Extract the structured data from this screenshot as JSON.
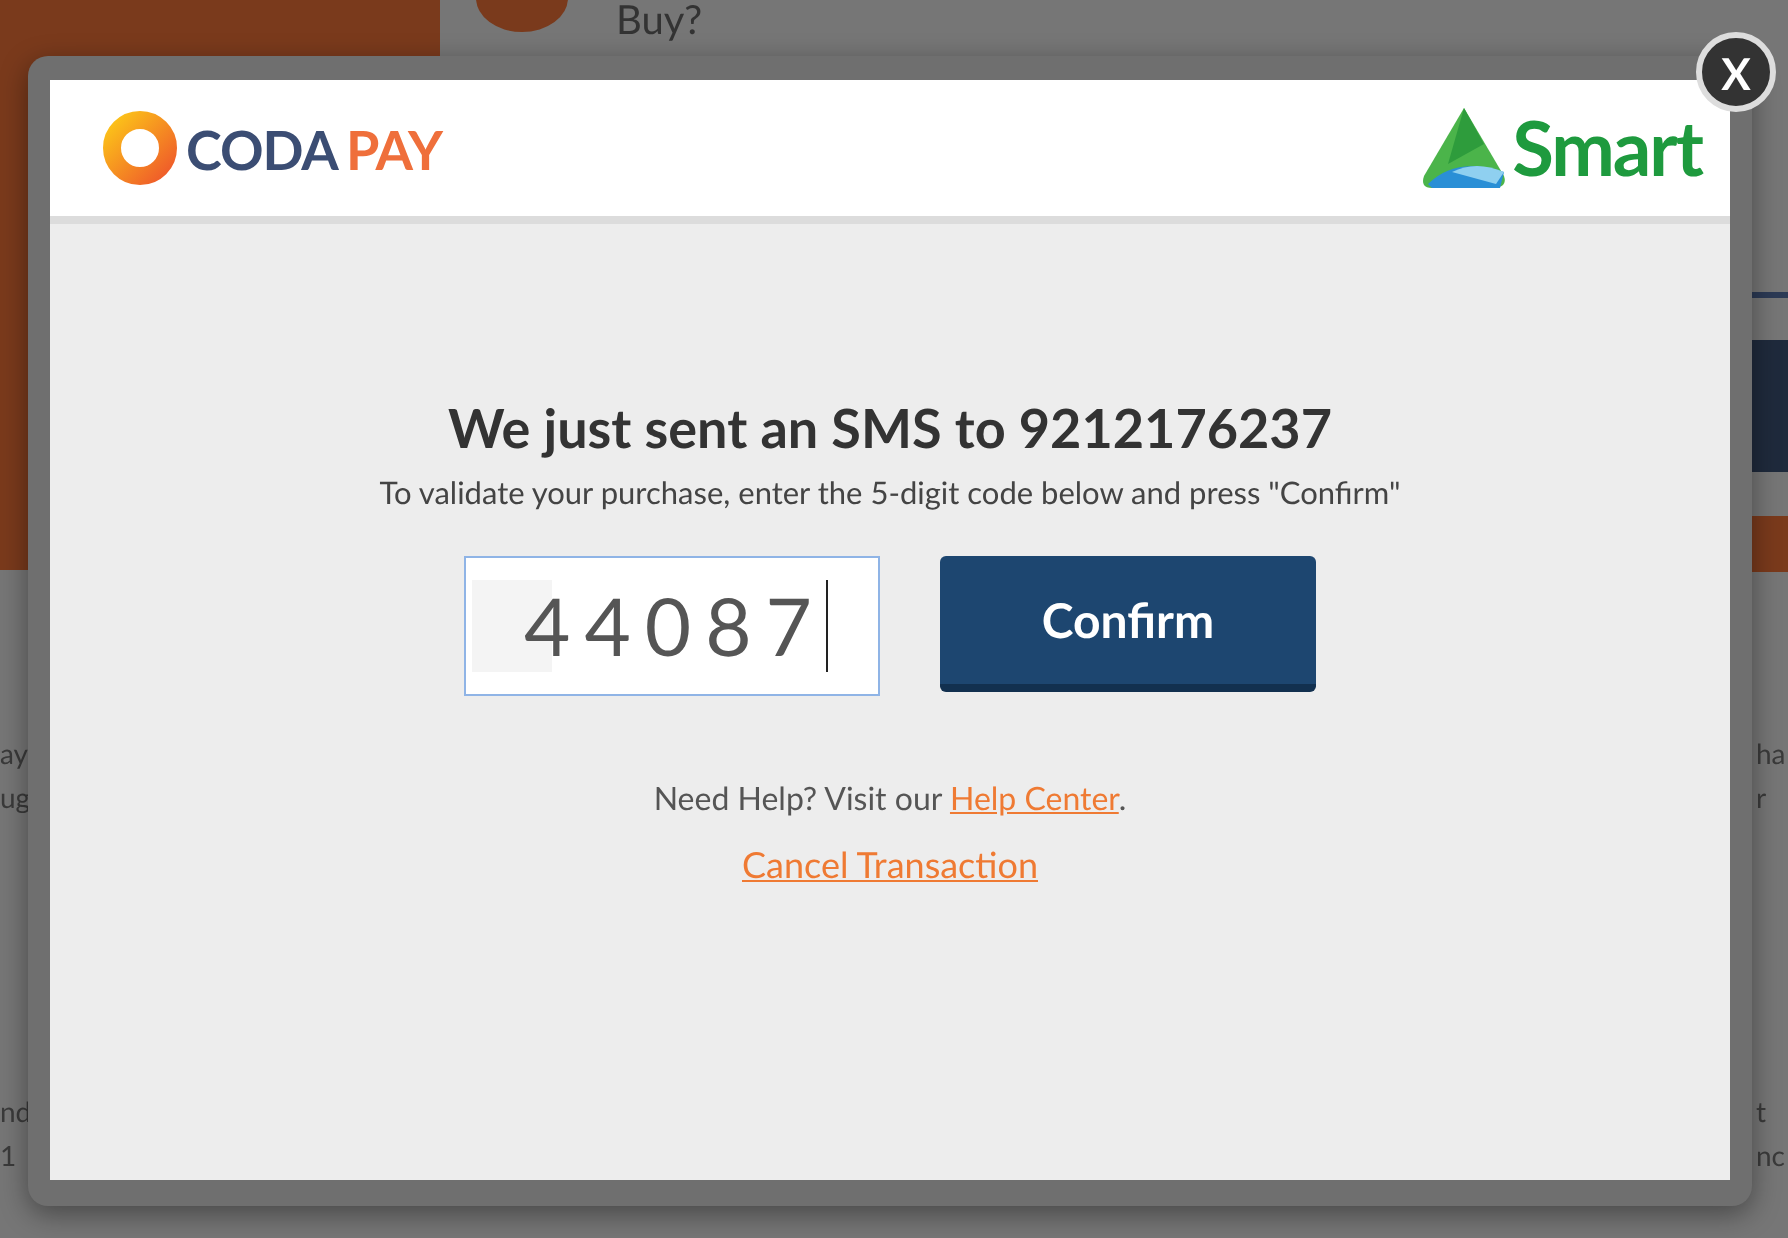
{
  "background": {
    "heading": "Buy?",
    "left_fragments": [
      "ay",
      "ug",
      "nd",
      "1"
    ],
    "right_fragments": [
      "ha",
      "r",
      "t",
      "nc"
    ]
  },
  "dialog": {
    "close_label": "X",
    "brand_logo": {
      "part_1": "CODA",
      "part_2": "PAY"
    },
    "carrier_logo": {
      "text": "Smart"
    },
    "title": "We just sent an SMS to 9212176237",
    "instruction": "To validate your purchase, enter the 5-digit code below and press \"Confirm\"",
    "code_field": {
      "value": "44087"
    },
    "confirm_button": "Confirm",
    "help_text": "Need Help? Visit our",
    "help_link": "Help Center",
    "help_end": ".",
    "cancel_link": "Cancel Transaction"
  }
}
